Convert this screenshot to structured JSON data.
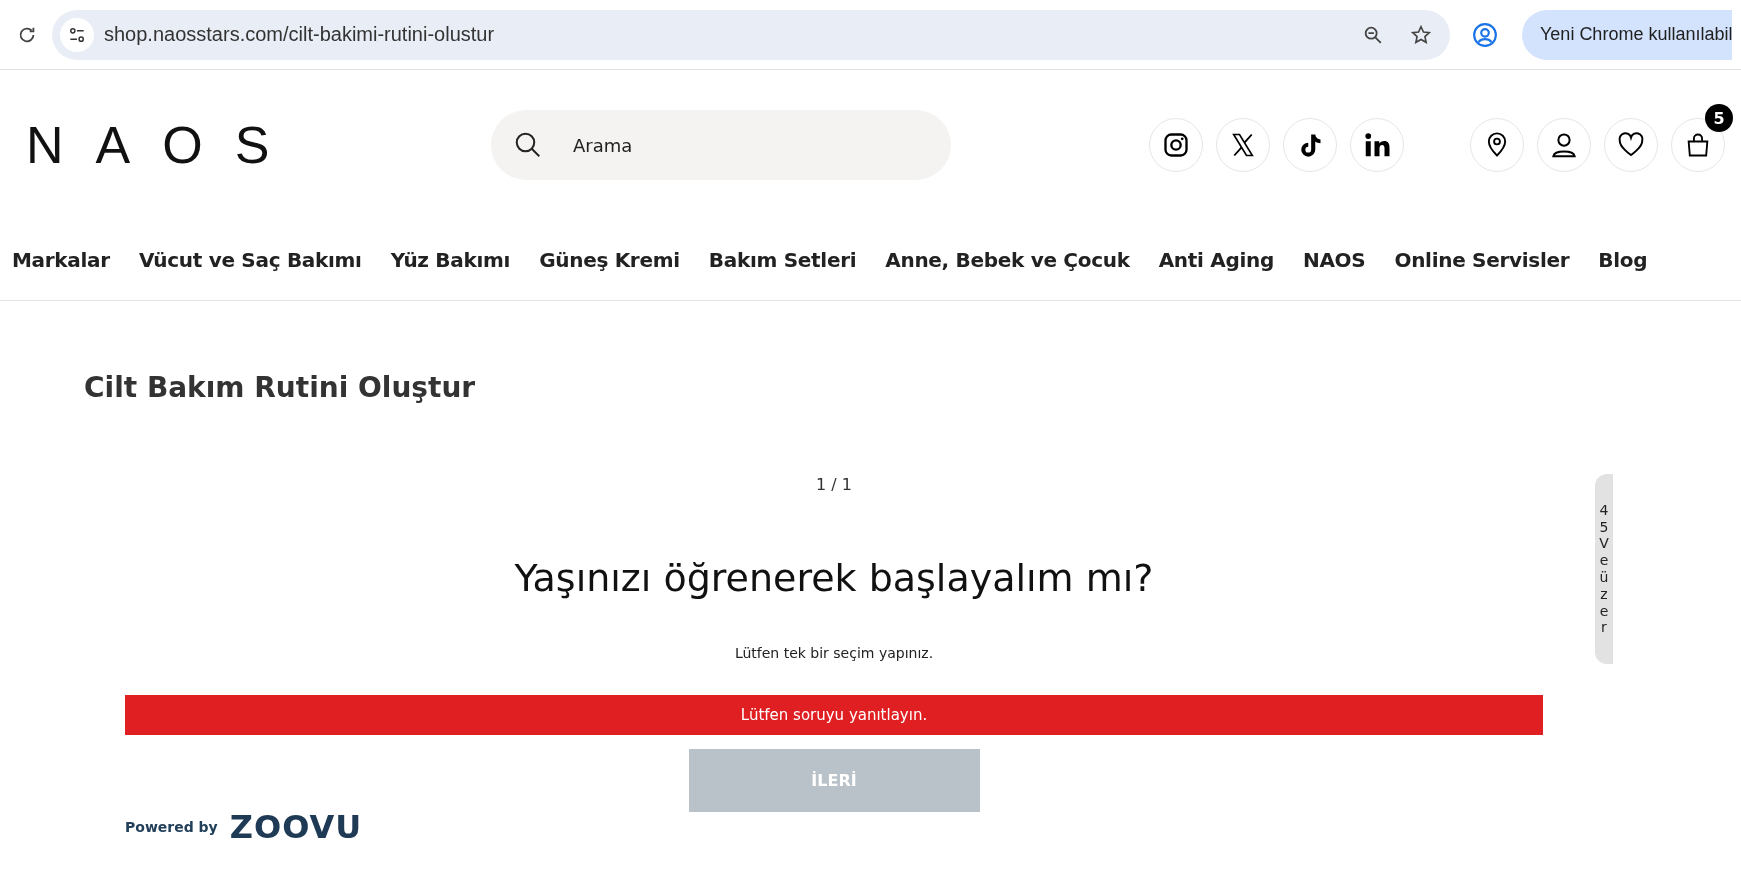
{
  "browser": {
    "url": "shop.naosstars.com/cilt-bakimi-rutini-olustur",
    "update_button": "Yeni Chrome kullanılabil"
  },
  "header": {
    "logo": "NAOS",
    "search": {
      "placeholder": "Arama"
    },
    "cart_count": "5"
  },
  "nav": [
    {
      "label": "Markalar"
    },
    {
      "label": "Vücut ve Saç Bakımı"
    },
    {
      "label": "Yüz Bakımı"
    },
    {
      "label": "Güneş Kremi"
    },
    {
      "label": "Bakım Setleri"
    },
    {
      "label": "Anne, Bebek ve Çocuk"
    },
    {
      "label": "Anti Aging"
    },
    {
      "label": "NAOS"
    },
    {
      "label": "Online Servisler"
    },
    {
      "label": "Blog"
    }
  ],
  "page": {
    "title": "Cilt Bakım Rutini Oluştur",
    "progress": "1 / 1",
    "question": "Yaşınızı öğrenerek başlayalım mı?",
    "hint": "Lütfen tek bir seçim yapınız.",
    "error": "Lütfen soruyu yanıtlayın.",
    "next_button": {
      "label": "İLERİ",
      "disabled": true
    },
    "powered_by": "Powered by",
    "brand": "ZOOVU"
  },
  "side_tab": {
    "chars": [
      "4",
      "5",
      "V",
      "e",
      "ü",
      "z",
      "e",
      "r"
    ]
  }
}
